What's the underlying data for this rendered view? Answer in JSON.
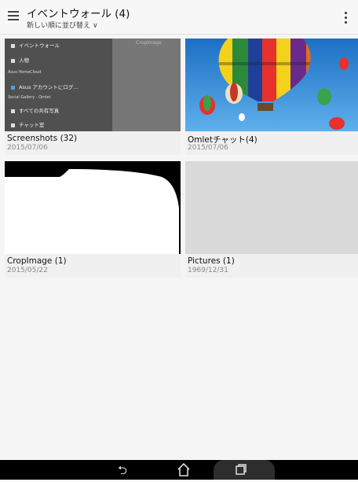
{
  "appbar": {
    "title": "イベントウォール (4)",
    "sort_label": "新しい順に並び替え",
    "menu_icon": "hamburger-icon",
    "overflow_icon": "more-vert-icon"
  },
  "albums": [
    {
      "name": "Screenshots (32)",
      "date": "2015/07/06"
    },
    {
      "name": "Omletチャット(4)",
      "date": "2015/07/06"
    },
    {
      "name": "CropImage (1)",
      "date": "2015/05/22"
    },
    {
      "name": "Pictures (1)",
      "date": "1969/12/31"
    }
  ],
  "drawer_preview": {
    "items": [
      "イベントウォール",
      "人物",
      "Asus HomeCloud",
      "Asus アカウントにログ...",
      "Social Gallery - Omlet",
      "すべての共有写真",
      "チャット室"
    ],
    "ghost_text": "CropImage"
  },
  "navbar": {
    "back_icon": "back-icon",
    "home_icon": "home-icon",
    "recents_icon": "recents-icon"
  },
  "colors": {
    "appbar_bg": "#f7f7f7",
    "navbar_bg": "#000000",
    "sky_blue": "#2c89d8"
  }
}
